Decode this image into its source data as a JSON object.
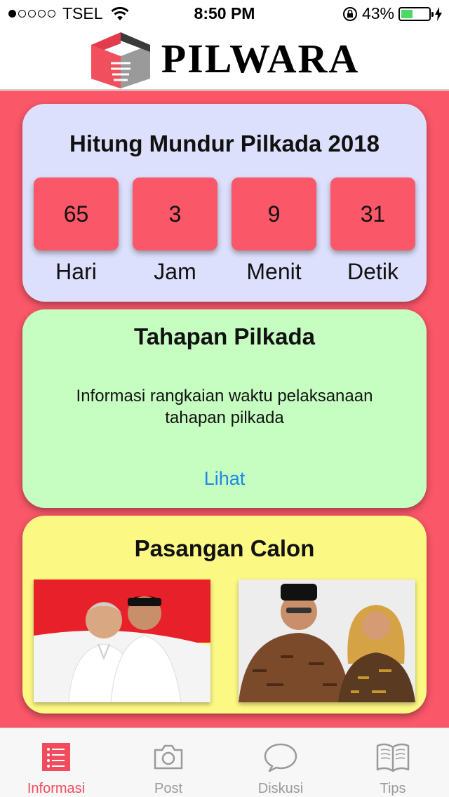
{
  "status_bar": {
    "carrier": "TSEL",
    "time": "8:50 PM",
    "battery_percent": "43%",
    "battery_level": 0.43,
    "signal_bars": 1,
    "signal_total": 5
  },
  "header": {
    "brand": "PILWARA",
    "logo_icon": "ballot-box-logo-icon"
  },
  "countdown": {
    "title": "Hitung Mundur Pilkada 2018",
    "units": [
      {
        "value": "65",
        "label": "Hari"
      },
      {
        "value": "3",
        "label": "Jam"
      },
      {
        "value": "9",
        "label": "Menit"
      },
      {
        "value": "31",
        "label": "Detik"
      }
    ]
  },
  "tahapan": {
    "title": "Tahapan Pilkada",
    "description": "Informasi rangkaian waktu pelaksanaan tahapan pilkada",
    "link": "Lihat"
  },
  "paslon": {
    "title": "Pasangan Calon",
    "photos": [
      "candidate-pair-photo-1",
      "candidate-pair-photo-2"
    ]
  },
  "tabs": [
    {
      "label": "Informasi",
      "icon": "list-icon",
      "active": true
    },
    {
      "label": "Post",
      "icon": "camera-icon",
      "active": false
    },
    {
      "label": "Diskusi",
      "icon": "chat-bubble-icon",
      "active": false
    },
    {
      "label": "Tips",
      "icon": "book-icon",
      "active": false
    }
  ],
  "colors": {
    "accent_red": "#fa5768",
    "countdown_bg": "#dde0fc",
    "tahapan_bg": "#c6fec1",
    "paslon_bg": "#fcf884",
    "link_blue": "#1e88e5",
    "active_tab": "#f24b5e"
  }
}
